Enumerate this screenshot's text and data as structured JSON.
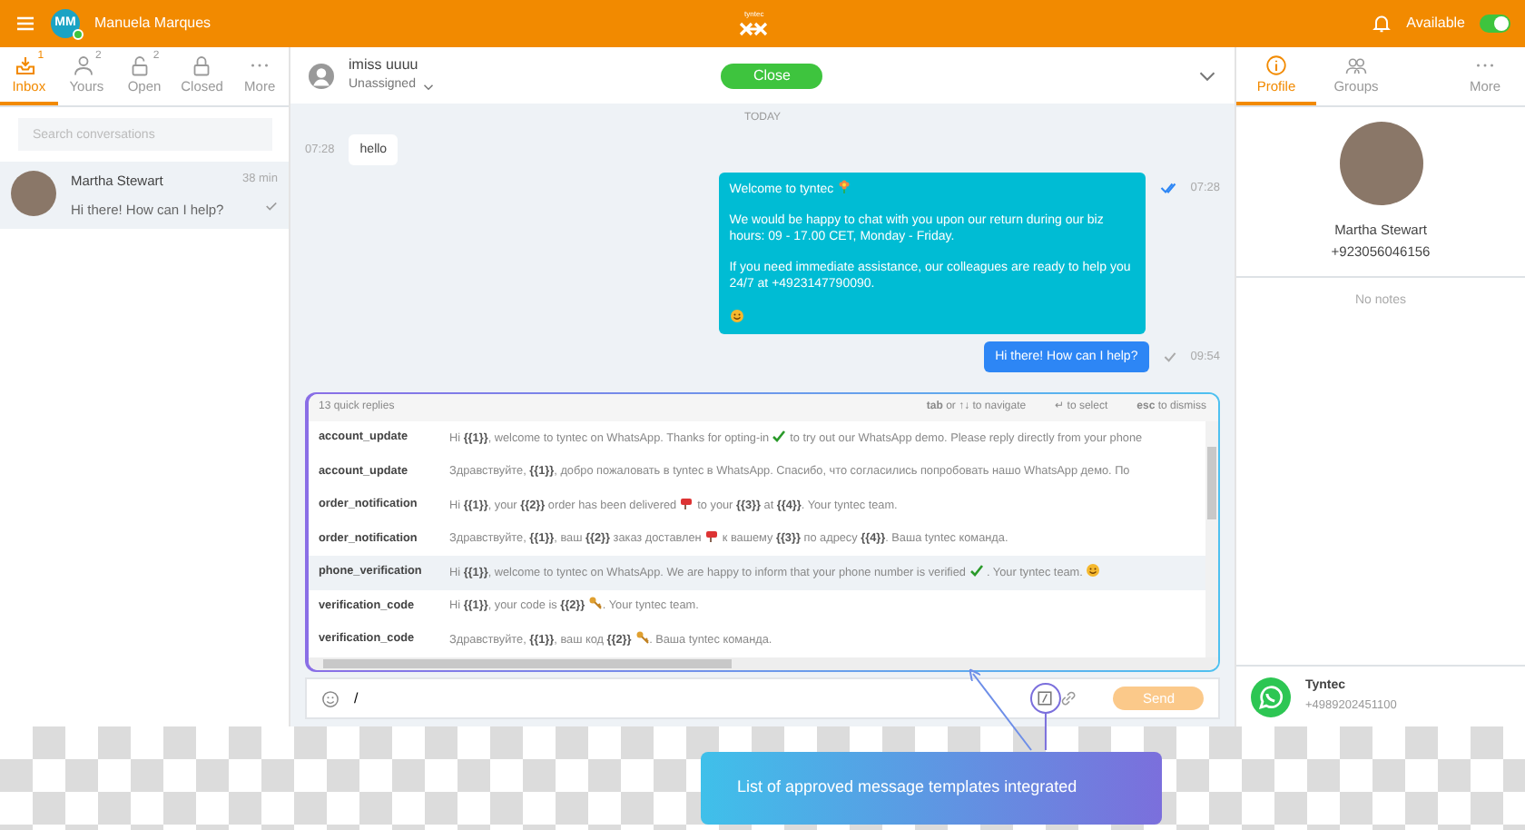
{
  "header": {
    "user_initials": "MM",
    "user_name": "Manuela Marques",
    "logo_text": "tyntec",
    "status": "Available",
    "available_on": true
  },
  "inbox_tabs": [
    {
      "label": "Inbox",
      "count": "1",
      "kind": "inbox",
      "selected": true
    },
    {
      "label": "Yours",
      "count": "2",
      "kind": "user",
      "selected": false
    },
    {
      "label": "Open",
      "count": "2",
      "kind": "unlock",
      "selected": false
    },
    {
      "label": "Closed",
      "kind": "lock",
      "selected": false
    },
    {
      "label": "More",
      "kind": "more",
      "selected": false
    }
  ],
  "search": {
    "placeholder": "Search conversations"
  },
  "conversations": [
    {
      "name": "Martha Stewart",
      "time": "38 min",
      "preview": "Hi there! How can I help?",
      "selected": true
    }
  ],
  "chat": {
    "contact": "imiss uuuu",
    "assignee": "Unassigned",
    "close_button": "Close",
    "day": "TODAY",
    "messages": [
      {
        "kind": "incoming",
        "time": "07:28",
        "paragraphs": [
          [
            {
              "kind": "text",
              "text": "hello"
            }
          ]
        ]
      },
      {
        "kind": "outgoing",
        "time": "07:28",
        "read": true,
        "paragraphs": [
          [
            {
              "kind": "text",
              "text": "Welcome to tyntec "
            },
            {
              "kind": "flower"
            }
          ],
          [
            {
              "kind": "text",
              "text": "We would be happy to chat with you upon our return during our biz hours: 09 - 17.00 CET, Monday - Friday."
            }
          ],
          [
            {
              "kind": "text",
              "text": "If you need immediate assistance, our colleagues are ready to help you 24/7 at +4923147790090."
            }
          ],
          [
            {
              "kind": "smile"
            }
          ]
        ]
      },
      {
        "kind": "outgoing",
        "time": "09:54",
        "read": false,
        "paragraphs": [
          [
            {
              "kind": "text",
              "text": "Hi there! How can I help?"
            }
          ]
        ]
      }
    ]
  },
  "quick_replies": {
    "count_label": "13 quick replies",
    "hints": [
      "**tab** or ↑↓ to navigate",
      "↵ to select",
      "**esc** to dismiss"
    ],
    "items": [
      {
        "name": "account_update",
        "selected": false,
        "parts": [
          {
            "kind": "text",
            "text": "Hi **{{1}}**, welcome to tyntec on WhatsApp. Thanks for opting-in "
          },
          {
            "kind": "check"
          },
          {
            "kind": "text",
            "text": " to try out our WhatsApp demo. Please reply directly from your phone"
          }
        ]
      },
      {
        "name": "account_update",
        "selected": false,
        "parts": [
          {
            "kind": "text",
            "text": "Здравствуйте, **{{1}}**, добро пожаловать в tyntec в WhatsApp. Спасибо, что согласились попробовать нашо WhatsApp демо. По"
          }
        ]
      },
      {
        "name": "order_notification",
        "selected": false,
        "parts": [
          {
            "kind": "text",
            "text": "Hi **{{1}}**, your **{{2}}** order has been delivered "
          },
          {
            "kind": "mailbox"
          },
          {
            "kind": "text",
            "text": " to your **{{3}}** at **{{4}}**. Your tyntec team."
          }
        ]
      },
      {
        "name": "order_notification",
        "selected": false,
        "parts": [
          {
            "kind": "text",
            "text": "Здравствуйте, **{{1}}**, ваш **{{2}}** заказ доставлен "
          },
          {
            "kind": "mailbox"
          },
          {
            "kind": "text",
            "text": " к вашему **{{3}}** по адресу **{{4}}**. Ваша tyntec команда."
          }
        ]
      },
      {
        "name": "phone_verification",
        "selected": true,
        "parts": [
          {
            "kind": "text",
            "text": "Hi **{{1}}**, welcome to tyntec on WhatsApp. We are happy to inform that your phone number is verified "
          },
          {
            "kind": "check"
          },
          {
            "kind": "text",
            "text": " . Your tyntec team. "
          },
          {
            "kind": "smile"
          }
        ]
      },
      {
        "name": "verification_code",
        "selected": false,
        "parts": [
          {
            "kind": "text",
            "text": "Hi **{{1}}**, your code is **{{2}}** "
          },
          {
            "kind": "key"
          },
          {
            "kind": "text",
            "text": ". Your tyntec team."
          }
        ]
      },
      {
        "name": "verification_code",
        "selected": false,
        "parts": [
          {
            "kind": "text",
            "text": "Здравствуйте, **{{1}}**, ваш код **{{2}}** "
          },
          {
            "kind": "key"
          },
          {
            "kind": "text",
            "text": ". Ваша tyntec команда."
          }
        ]
      }
    ]
  },
  "composer": {
    "value": "/",
    "send_button": "Send",
    "send_disabled": true
  },
  "profile": {
    "tabs": [
      {
        "label": "Profile",
        "kind": "info",
        "selected": true
      },
      {
        "label": "Groups",
        "kind": "groups",
        "selected": false
      },
      {
        "label": "More",
        "kind": "more",
        "selected": false
      }
    ],
    "name": "Martha Stewart",
    "phone": "+923056046156",
    "notes": "No notes",
    "channel_name": "Tyntec",
    "channel_number": "+4989202451100"
  },
  "callout": {
    "text": "List of approved message templates integrated"
  }
}
